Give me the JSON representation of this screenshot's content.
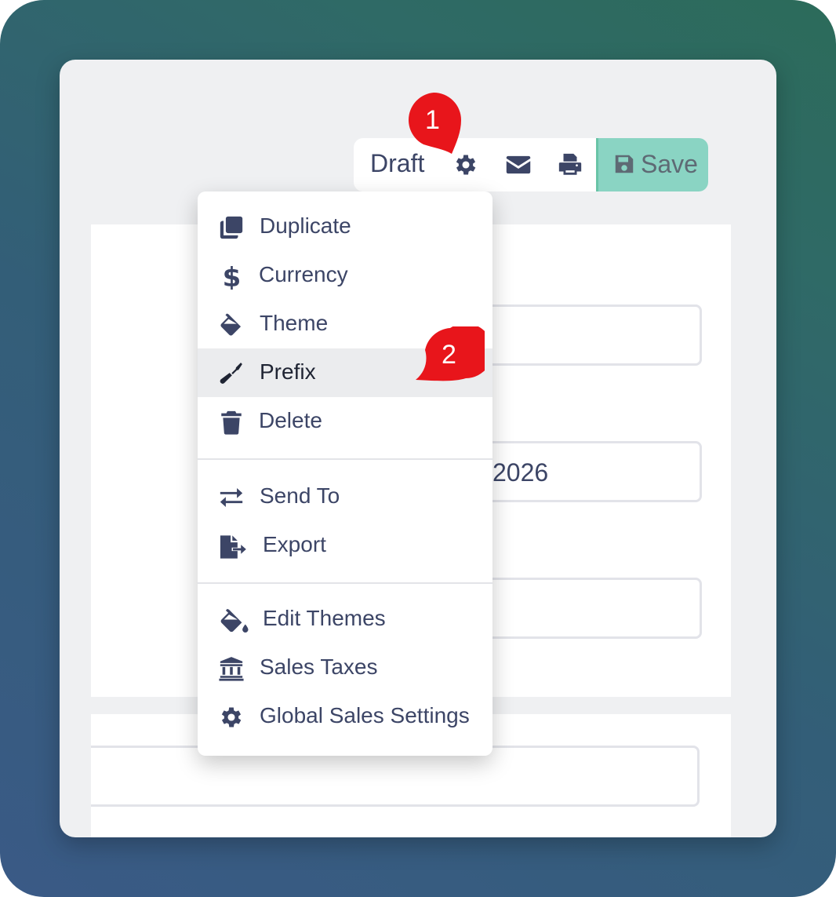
{
  "toolbar": {
    "status": "Draft",
    "save_label": "Save",
    "icons": [
      "gear-icon",
      "envelope-icon",
      "print-icon",
      "save-icon"
    ]
  },
  "form": {
    "date_fragment": "2026"
  },
  "menu": {
    "items": [
      {
        "label": "Duplicate",
        "icon": "duplicate-icon"
      },
      {
        "label": "Currency",
        "icon": "dollar-icon"
      },
      {
        "label": "Theme",
        "icon": "fill-icon"
      },
      {
        "label": "Prefix",
        "icon": "screwdriver-icon",
        "highlighted": true
      },
      {
        "label": "Delete",
        "icon": "trash-icon"
      },
      {
        "label": "Send To",
        "icon": "exchange-icon"
      },
      {
        "label": "Export",
        "icon": "file-export-icon"
      },
      {
        "label": "Edit Themes",
        "icon": "fill-drip-icon"
      },
      {
        "label": "Sales Taxes",
        "icon": "bank-icon"
      },
      {
        "label": "Global Sales Settings",
        "icon": "gear-icon"
      }
    ]
  },
  "callouts": {
    "first": "1",
    "second": "2"
  },
  "colors": {
    "accent_save": "#8ad4c3",
    "callout_red": "#e8151b",
    "text_dark": "#3c4566"
  }
}
